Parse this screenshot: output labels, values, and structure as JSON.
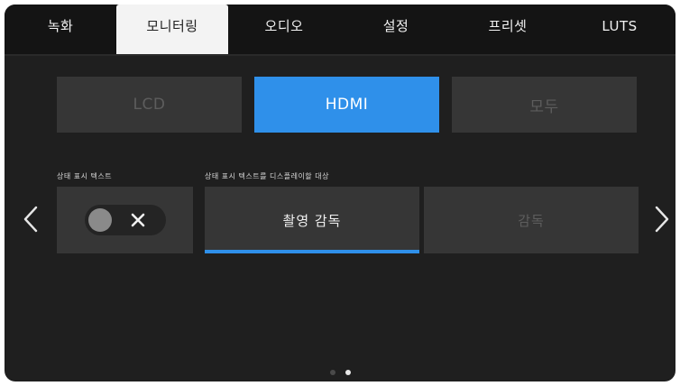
{
  "tabs": [
    {
      "label": "녹화",
      "active": false
    },
    {
      "label": "모니터링",
      "active": true
    },
    {
      "label": "오디오",
      "active": false
    },
    {
      "label": "설정",
      "active": false
    },
    {
      "label": "프리셋",
      "active": false
    },
    {
      "label": "LUTS",
      "active": false
    }
  ],
  "outputs": [
    {
      "label": "LCD",
      "active": false
    },
    {
      "label": "HDMI",
      "active": true
    },
    {
      "label": "모두",
      "active": false
    }
  ],
  "status_text": {
    "label": "상태 표시 텍스트",
    "toggle_state": "off"
  },
  "display_target": {
    "label": "상태 표시 텍스트를 디스플레이할 대상",
    "options": [
      {
        "label": "촬영 감독",
        "active": true
      },
      {
        "label": "감독",
        "active": false
      }
    ]
  },
  "pagination": {
    "total": 2,
    "current": 2
  },
  "colors": {
    "accent": "#2f90ea",
    "background": "#1f1f1f",
    "tabbar": "#141414",
    "button": "#363636"
  },
  "icons": {
    "prev": "chevron-left-icon",
    "next": "chevron-right-icon",
    "toggle_off": "close-icon"
  }
}
